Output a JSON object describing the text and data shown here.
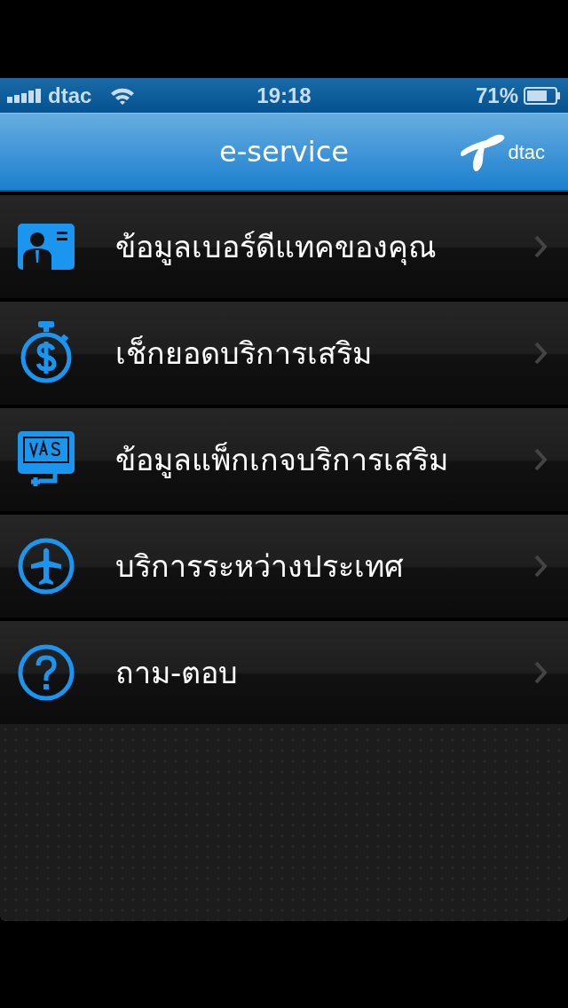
{
  "status_bar": {
    "carrier": "dtac",
    "time": "19:18",
    "battery": "71%"
  },
  "nav_bar": {
    "title": "e-service",
    "logo_text": "dtac"
  },
  "menu": [
    {
      "label": "ข้อมูลเบอร์ดีแทคของคุณ"
    },
    {
      "label": "เช็กยอดบริการเสริม"
    },
    {
      "label": "ข้อมูลแพ็กเกจบริการเสริม"
    },
    {
      "label": "บริการระหว่างประเทศ"
    },
    {
      "label": "ถาม-ตอบ"
    }
  ]
}
